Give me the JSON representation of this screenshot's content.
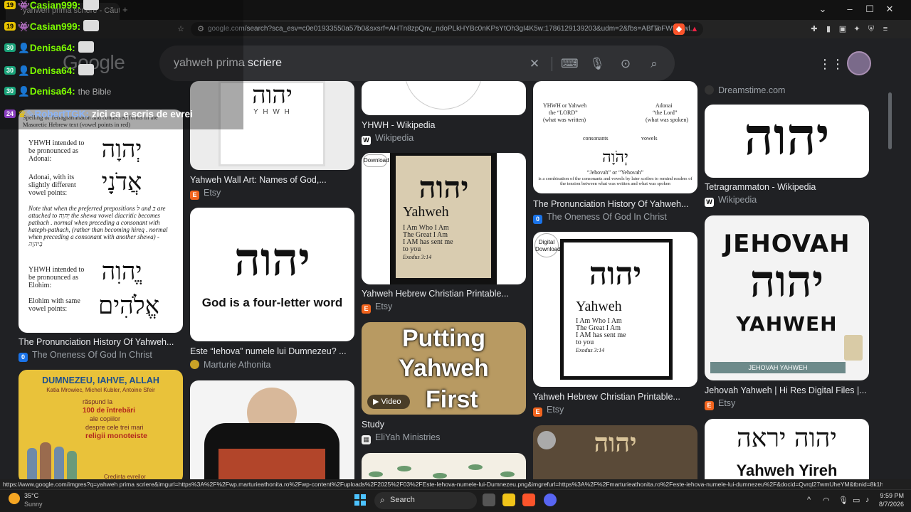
{
  "browser": {
    "tab_title": "yahweh prima scriere - Căutare",
    "url": "google.com/search?sca_esv=c0e01933550a57b0&sxsrf=AHTn8zpQnv_ndoPLkHYBc0nKPsYtOh3gI4K5w:1786129139203&udm=2&fbs=ABfTbFWfH4wl...",
    "status_url": "https://www.google.com/imgres?q=yahweh prima scriere&imgurl=https%3A%2F%2Fwp.marturieathonita.ro%2Fwp-content%2Fuploads%2F2025%2F03%2FEste-Iehova-numele-lui-Dumnezeu.png&imgrefurl=https%3A%2F%2Fmarturieathonita.ro%2Feste-iehova-numele-lui-dumnezeu%2F&docid=Qvrql27wmUheYM&tbnid=8k1h5LhTBlEueM&ve..."
  },
  "search": {
    "logo": "Google",
    "query": "yahweh prima scriere"
  },
  "chat": [
    {
      "badge": "19",
      "user": "Casian999:",
      "msg": ""
    },
    {
      "badge": "19",
      "user": "Casian999:",
      "msg": ""
    },
    {
      "badge": "30",
      "user": "Denisa64:",
      "msg": ""
    },
    {
      "badge": "30",
      "user": "Denisa64:",
      "msg": ""
    },
    {
      "badge": "30",
      "user": "Denisa64:",
      "msg": ""
    },
    {
      "badge": "24",
      "user": "RobertTGK:",
      "msg": "zici ca e scris de evrei"
    }
  ],
  "results": {
    "c1": {
      "title": "The Pronunciation History Of Yahweh...",
      "source": "The Oneness Of God In Christ",
      "overlay": "the Bible",
      "header": "Spelling of Tetragrammaton and connected forms in the Masoretic Hebrew text (vowel points in red)",
      "heb1": "יְהוָה",
      "heb2": "אֲדֹנָי",
      "heb3": "יֱהוִה",
      "heb4": "אֱלֹהִים",
      "t1": "YHWH intended to be pronounced as Adonai:",
      "t2": "Adonai, with its slightly different vowel points:",
      "t3": "Note that when the preferred prepositions ל and ב are attached to יְהוָה the shewa vowel diacritic becomes pathach . normal when preceding a consonant with hateph-pathach, (rather than becoming hireq . normal when preceding a consonant with another shewa) - בַיהוָה",
      "t4": "YHWH intended to be pronounced as Elohim:",
      "t5": "Elohim with same vowel points:"
    },
    "c1b": {
      "title": "DUMNEZEU, IAHVE, ALLAH",
      "authors": "Katia Mrowiec, Michel Kubler, Antoine Sfeir",
      "l1": "răspund la",
      "l2": "100 de întrebări",
      "l3": "ale copiilor",
      "l4": "despre cele trei mari",
      "l5": "religii monoteiste",
      "l6": "Credința evreilor"
    },
    "c2": {
      "title": "Yahweh Wall Art: Names of God,...",
      "source": "Etsy",
      "heb": "יהוה",
      "latin": "Y H W H"
    },
    "c2b": {
      "title": "Este “Iehova” numele lui Dumnezeu? ...",
      "source": "Marturie Athonita",
      "heb": "יהוה",
      "caption": "God is a four-letter word"
    },
    "c3": {
      "title": "YHWH - Wikipedia",
      "source": "Wikipedia"
    },
    "c3b": {
      "title": "Yahweh Hebrew Christian Printable...",
      "source": "Etsy",
      "badge": "Download",
      "heb": "יהוה",
      "name": "Yahweh",
      "v1": "I Am Who I Am",
      "v2": "The Great I Am",
      "v3": "I AM has sent me",
      "v4": "to you",
      "ref": "Exodus 3:14"
    },
    "c3c": {
      "title": "Study",
      "source": "EliYah Ministries",
      "t1": "Putting",
      "t2": "Yahweh",
      "t3": "First",
      "video": "Video"
    },
    "c4": {
      "title": "The Pronunciation History Of Yahweh...",
      "source": "The Oneness Of God In Christ",
      "a1": "YHWH or Yahweh",
      "a2": "the “LORD”",
      "a3": "(what was written)",
      "b1": "Adonai",
      "b2": "“the Lord”",
      "b3": "(what was spoken)",
      "cons": "consonants",
      "vow": "vowels",
      "heb": "יְהֹוָה",
      "jeh": "“Jehovah” or “Yehovah”",
      "foot": "is a combination of the consonants and vowels by later scribes to remind readers of the tension between what was written and what was spoken"
    },
    "c4b": {
      "title": "Yahweh Hebrew Christian Printable...",
      "source": "Etsy",
      "badge1": "Digital",
      "badge2": "Download",
      "heb": "יהוה",
      "name": "Yahweh",
      "v1": "I Am Who I Am",
      "v2": "The Great I Am",
      "v3": "I AM has sent me",
      "v4": "to you",
      "ref": "Exodus 3:14"
    },
    "c4c": {
      "heb": "יהוה"
    },
    "c5": {
      "title": "Tetragrammaton - Wikipedia",
      "source": "Wikipedia",
      "heb": "יהוה",
      "topsource": "Dreamstime.com"
    },
    "c5b": {
      "title": "Jehovah Yahweh | Hi Res Digital Files |...",
      "source": "Etsy",
      "top": "JEHOVAH",
      "heb": "יהוה",
      "bottom": "YAHWEH",
      "banner": "JEHOVAH YAHWEH"
    },
    "c5c": {
      "heb": "יהוה יראה",
      "text": "Yahweh Yireh"
    }
  },
  "taskbar": {
    "temp": "35°C",
    "weather": "Sunny",
    "search": "Search",
    "time": "9:59 PM",
    "date": "8/7/2026"
  },
  "colors": {
    "etsy": "#f1641e",
    "wiki": "#ffffff",
    "oneness": "#1a73e8",
    "chat_name": "#7cfc00",
    "chat_name_robert": "#8ab4f8"
  }
}
